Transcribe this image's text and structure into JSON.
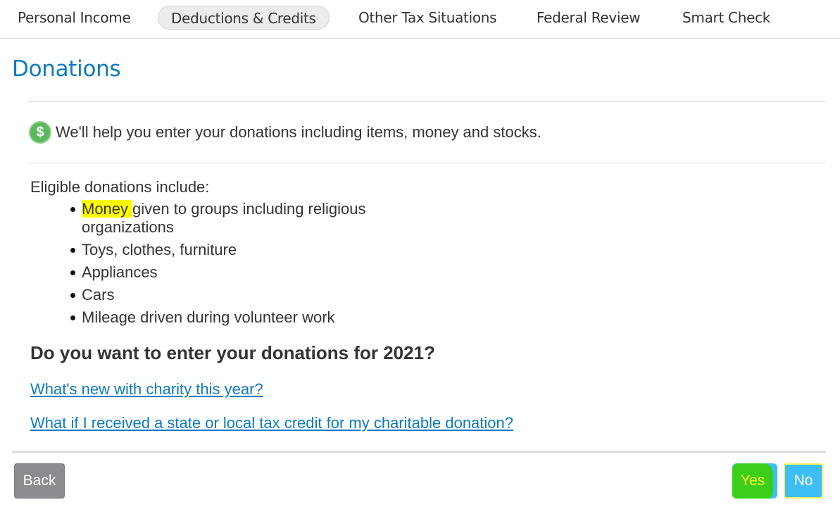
{
  "nav": {
    "tabs": [
      {
        "label": "Personal Income"
      },
      {
        "label": "Deductions & Credits"
      },
      {
        "label": "Other Tax Situations"
      },
      {
        "label": "Federal Review"
      },
      {
        "label": "Smart Check"
      }
    ]
  },
  "page": {
    "title": "Donations",
    "intro": "We'll help you enter your donations including items, money and stocks.",
    "eligible_heading": "Eligible donations include:",
    "items": [
      {
        "highlight": "Money",
        "rest": "given to groups including religious organizations"
      },
      {
        "text": "Toys, clothes, furniture"
      },
      {
        "text": "Appliances"
      },
      {
        "text": "Cars"
      },
      {
        "text": "Mileage driven during volunteer work"
      }
    ],
    "question": "Do you want to enter your donations for 2021?",
    "links": [
      "What's new with charity this year?",
      "What if I received a state or local tax credit for my charitable donation?"
    ]
  },
  "buttons": {
    "back": "Back",
    "yes": "Yes",
    "no": "No"
  },
  "icons": {
    "intro_icon": "dollar-sign-icon"
  },
  "colors": {
    "title_blue": "#0d7ac4",
    "button_blue": "#3dbef5",
    "highlight_yellow": "#ffff00",
    "highlight_green": "#3ccf1a"
  }
}
